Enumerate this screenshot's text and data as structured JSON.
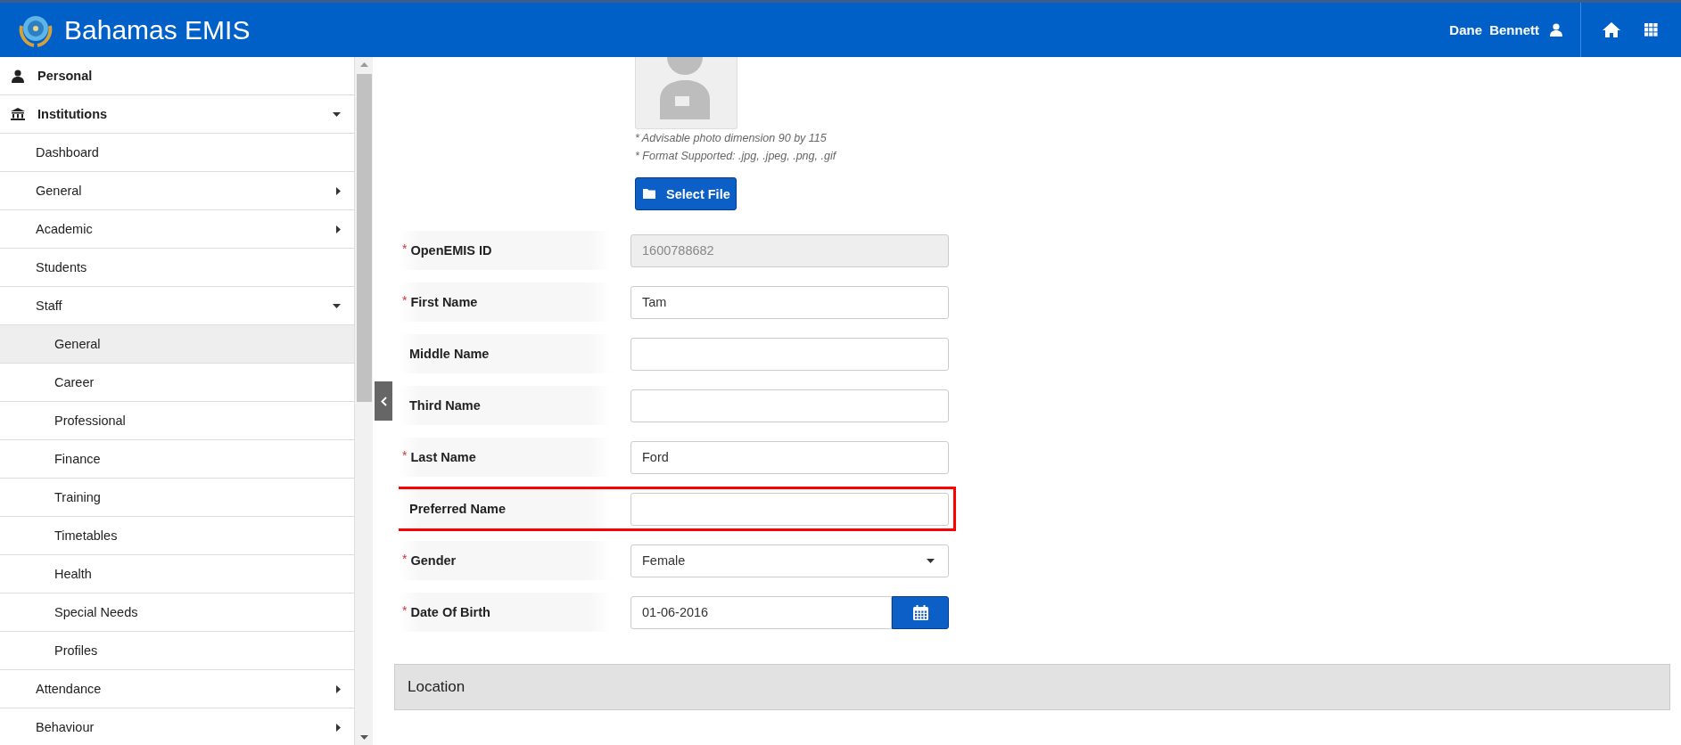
{
  "header": {
    "title": "Bahamas EMIS",
    "user": {
      "first_name": "Dane",
      "last_name": "Bennett"
    }
  },
  "sidebar": {
    "items": [
      {
        "label": "Personal",
        "selected": false
      },
      {
        "label": "Institutions",
        "selected": false,
        "expanded": true,
        "children": [
          {
            "label": "Dashboard",
            "selected": false
          },
          {
            "label": "General",
            "selected": false,
            "expanded": false
          },
          {
            "label": "Academic",
            "selected": false,
            "expanded": false
          },
          {
            "label": "Students",
            "selected": false
          },
          {
            "label": "Staff",
            "selected": false,
            "expanded": true,
            "children": [
              {
                "label": "General",
                "selected": true
              },
              {
                "label": "Career",
                "selected": false
              },
              {
                "label": "Professional",
                "selected": false
              },
              {
                "label": "Finance",
                "selected": false
              },
              {
                "label": "Training",
                "selected": false
              },
              {
                "label": "Timetables",
                "selected": false
              },
              {
                "label": "Health",
                "selected": false
              },
              {
                "label": "Special Needs",
                "selected": false
              },
              {
                "label": "Profiles",
                "selected": false
              }
            ]
          },
          {
            "label": "Attendance",
            "selected": false,
            "expanded": false
          },
          {
            "label": "Behaviour",
            "selected": false,
            "expanded": false
          }
        ]
      }
    ]
  },
  "photo": {
    "notes": [
      "* Advisable photo dimension 90 by 115",
      "* Format Supported: .jpg, .jpeg, .png, .gif"
    ],
    "button": "Select File"
  },
  "fields": [
    {
      "label": "OpenEMIS ID",
      "kind": "text",
      "required_mark": "*",
      "disabled": true,
      "highlighted": false,
      "value": "1600788682"
    },
    {
      "label": "First Name",
      "kind": "text",
      "required_mark": "*",
      "disabled": false,
      "highlighted": false,
      "value": "Tam"
    },
    {
      "label": "Middle Name",
      "kind": "text",
      "disabled": false,
      "highlighted": false
    },
    {
      "label": "Third Name",
      "kind": "text",
      "disabled": false,
      "highlighted": false
    },
    {
      "label": "Last Name",
      "kind": "text",
      "required_mark": "*",
      "disabled": false,
      "highlighted": false,
      "value": "Ford"
    },
    {
      "label": "Preferred Name",
      "kind": "text",
      "disabled": false,
      "highlighted": true
    },
    {
      "label": "Gender",
      "kind": "select",
      "required_mark": "*",
      "highlighted": false,
      "value": "Female"
    },
    {
      "label": "Date Of Birth",
      "kind": "date",
      "required_mark": "*",
      "highlighted": false,
      "value": "01-06-2016"
    }
  ],
  "section": {
    "title": "Location"
  }
}
